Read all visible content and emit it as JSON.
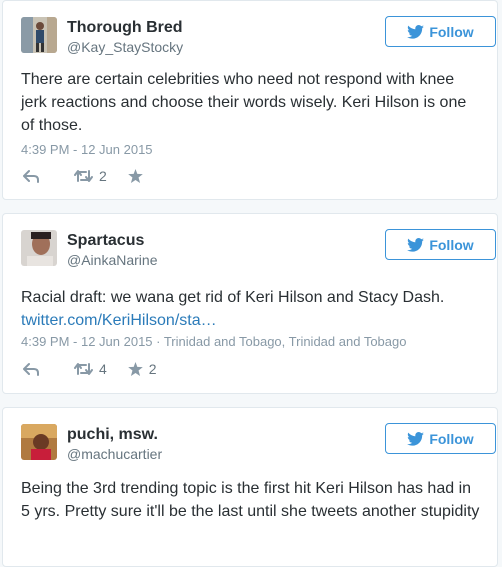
{
  "tweets": [
    {
      "name": "Thorough Bred",
      "handle": "@Kay_StayStocky",
      "follow_label": "Follow",
      "text": "There are certain celebrities who need not respond with knee jerk reactions and choose their words wisely. Keri Hilson is one of those.",
      "timestamp": "4:39 PM - 12 Jun 2015",
      "location": "",
      "retweets": "2",
      "favorites": ""
    },
    {
      "name": "Spartacus",
      "handle": "@AinkaNarine",
      "follow_label": "Follow",
      "text": "Racial draft: we wana get rid of Keri Hilson and Stacy Dash.",
      "link": "twitter.com/KeriHilson/sta…",
      "timestamp": "4:39 PM - 12 Jun 2015",
      "location": " · Trinidad and Tobago, Trinidad and Tobago",
      "retweets": "4",
      "favorites": "2"
    },
    {
      "name": "puchi, msw.",
      "handle": "@machucartier",
      "follow_label": "Follow",
      "text": "Being the 3rd trending topic is the first hit Keri Hilson has had in 5 yrs. Pretty sure it'll be the last until she tweets another stupidity"
    }
  ],
  "colors": {
    "accent": "#3b94d9",
    "link": "#2b7bb9",
    "muted": "#8899a6",
    "border": "#e1e8ed"
  },
  "icons": [
    "twitter-bird-icon",
    "reply-icon",
    "retweet-icon",
    "favorite-star-icon"
  ]
}
